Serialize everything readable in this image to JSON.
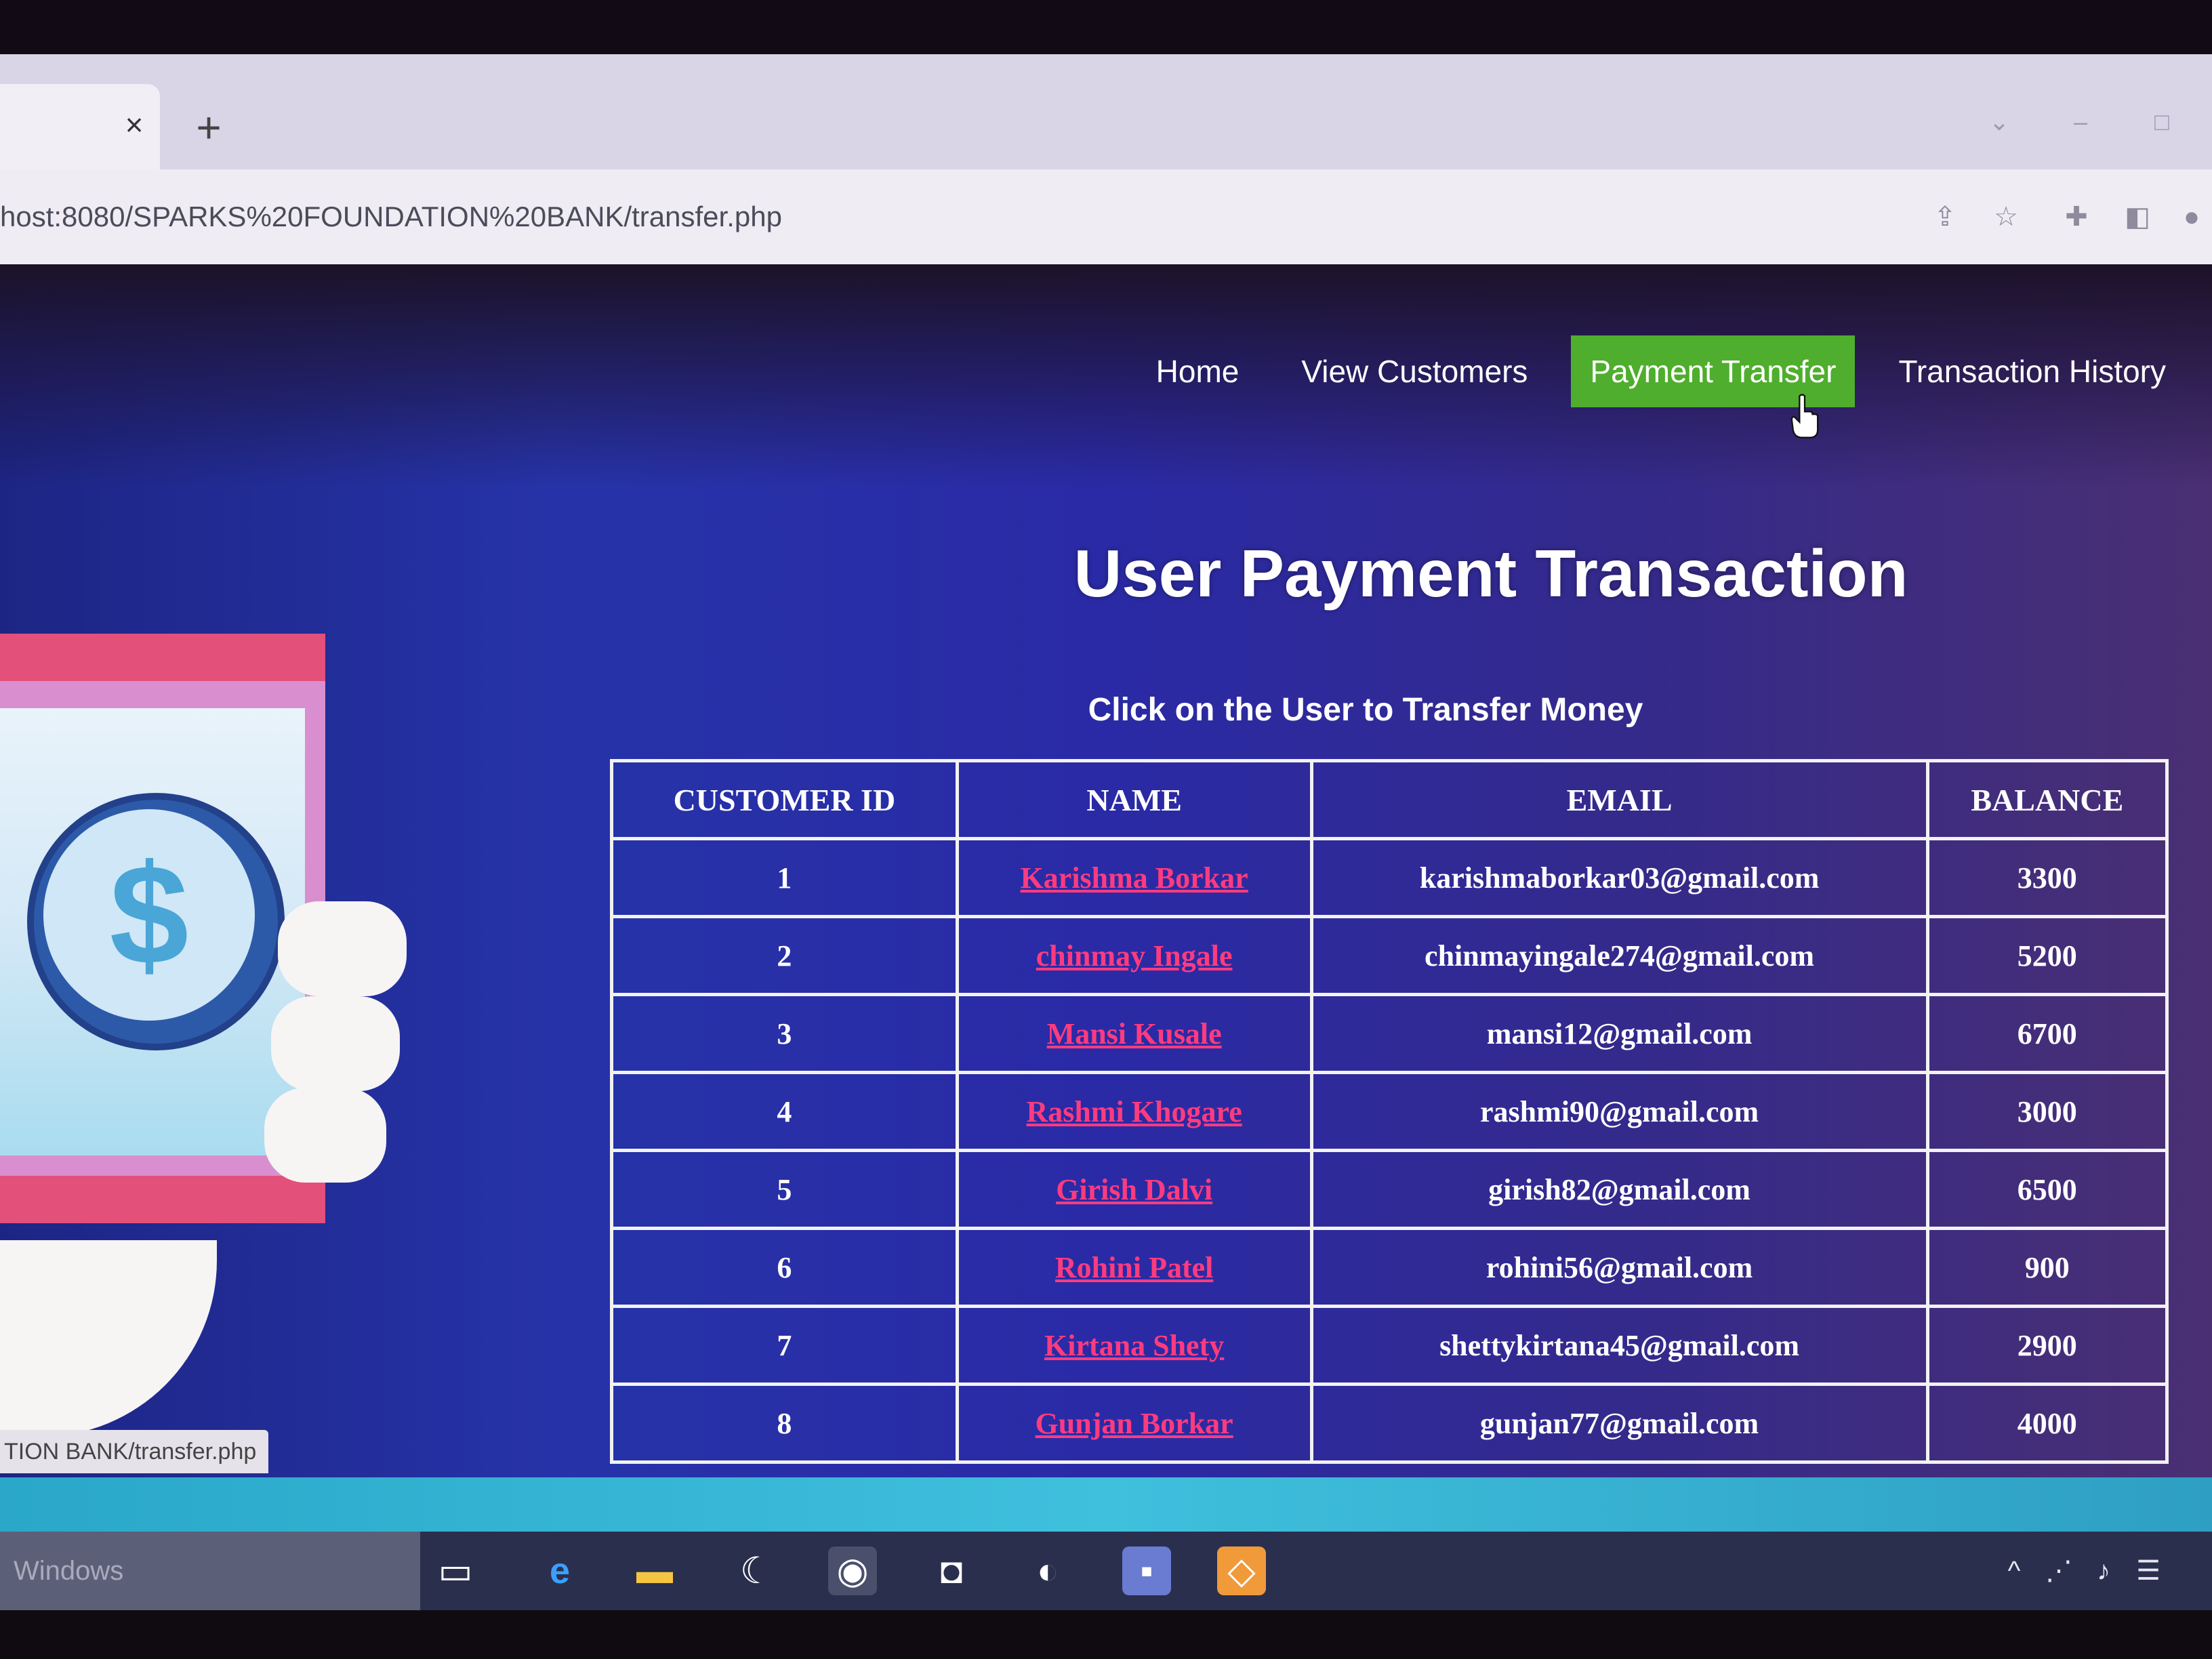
{
  "browser": {
    "tab_close_symbol": "×",
    "new_tab_symbol": "+",
    "url": "host:8080/SPARKS%20FOUNDATION%20BANK/transfer.php",
    "status_url": "TION BANK/transfer.php",
    "toolbar_icons": [
      "share-icon",
      "star-icon",
      "extensions-icon",
      "side-panel-icon",
      "profile-icon"
    ],
    "window_controls": [
      "chevron-down-icon",
      "minimize-icon",
      "maximize-icon"
    ]
  },
  "nav": {
    "items": [
      {
        "label": "Home"
      },
      {
        "label": "View Customers"
      },
      {
        "label": "Payment Transfer",
        "active": true
      },
      {
        "label": "Transaction History"
      }
    ],
    "active_color": "#4fae2d"
  },
  "page": {
    "title": "User Payment Transaction",
    "subtitle": "Click on the User to Transfer Money"
  },
  "illustration": {
    "icon": "dollar-coin-icon",
    "symbol": "$"
  },
  "table": {
    "headers": [
      "CUSTOMER ID",
      "NAME",
      "EMAIL",
      "BALANCE"
    ],
    "rows": [
      {
        "id": "1",
        "name": "Karishma Borkar",
        "email": "karishmaborkar03@gmail.com",
        "balance": "3300"
      },
      {
        "id": "2",
        "name": "chinmay Ingale",
        "email": "chinmayingale274@gmail.com",
        "balance": "5200"
      },
      {
        "id": "3",
        "name": "Mansi Kusale",
        "email": "mansi12@gmail.com",
        "balance": "6700"
      },
      {
        "id": "4",
        "name": "Rashmi Khogare",
        "email": "rashmi90@gmail.com",
        "balance": "3000"
      },
      {
        "id": "5",
        "name": "Girish Dalvi",
        "email": "girish82@gmail.com",
        "balance": "6500"
      },
      {
        "id": "6",
        "name": "Rohini Patel",
        "email": "rohini56@gmail.com",
        "balance": "900"
      },
      {
        "id": "7",
        "name": "Kirtana Shety",
        "email": "shettykirtana45@gmail.com",
        "balance": "2900"
      },
      {
        "id": "8",
        "name": "Gunjan Borkar",
        "email": "gunjan77@gmail.com",
        "balance": "4000"
      }
    ],
    "name_link_color": "#ff3b7f"
  },
  "taskbar": {
    "search_placeholder": "Windows",
    "apps": [
      "task-view-icon",
      "edge-icon",
      "file-explorer-icon",
      "display-icon",
      "chrome-icon",
      "camera-icon",
      "media-icon",
      "app-icon",
      "app-orange-icon"
    ],
    "tray": [
      "chevron-up-icon",
      "network-icon",
      "volume-icon",
      "notification-icon"
    ]
  }
}
